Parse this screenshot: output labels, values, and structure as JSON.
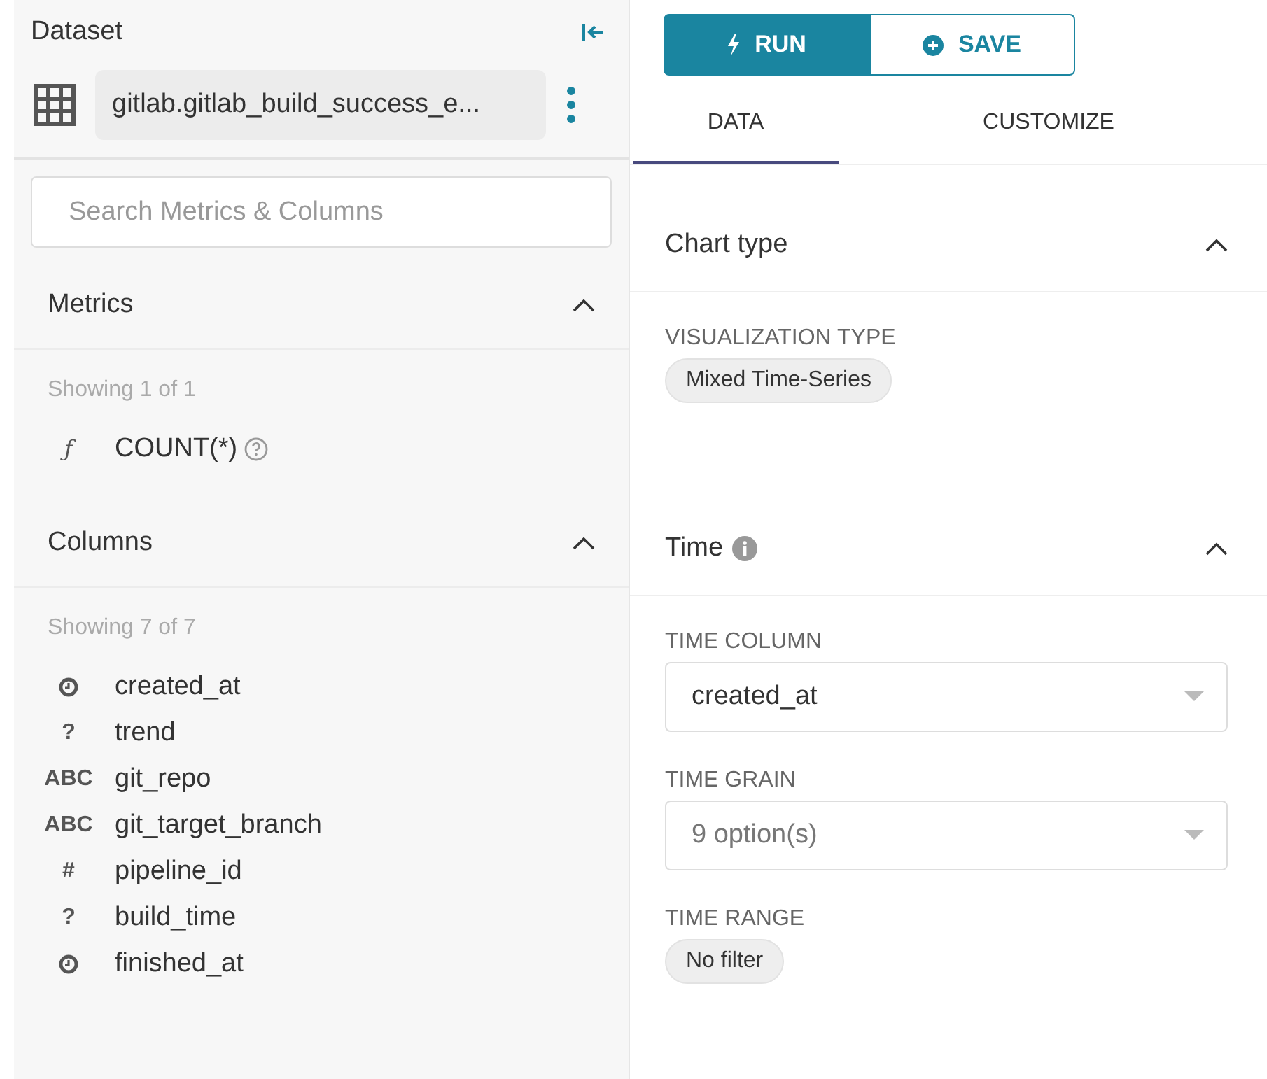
{
  "dataset": {
    "title": "Dataset",
    "name": "gitlab.gitlab_build_success_e..."
  },
  "search": {
    "placeholder": "Search Metrics & Columns"
  },
  "metrics": {
    "title": "Metrics",
    "expanded": true,
    "showing": "Showing 1 of 1",
    "items": [
      {
        "symbol": "ƒ",
        "name": "COUNT(*)",
        "help": true
      }
    ]
  },
  "columns": {
    "title": "Columns",
    "expanded": true,
    "showing": "Showing 7 of 7",
    "items": [
      {
        "kind": "time",
        "name": "created_at"
      },
      {
        "kind": "symbol",
        "symbol": "?",
        "name": "trend"
      },
      {
        "kind": "symbol",
        "symbol": "ABC",
        "name": "git_repo"
      },
      {
        "kind": "symbol",
        "symbol": "ABC",
        "name": "git_target_branch"
      },
      {
        "kind": "symbol",
        "symbol": "#",
        "name": "pipeline_id"
      },
      {
        "kind": "symbol",
        "symbol": "?",
        "name": "build_time"
      },
      {
        "kind": "time",
        "name": "finished_at"
      }
    ]
  },
  "buttons": [
    {
      "kind": "run",
      "label": "RUN"
    },
    {
      "kind": "save",
      "label": "SAVE"
    }
  ],
  "tabs": [
    {
      "label": "DATA",
      "selected": true
    },
    {
      "label": "CUSTOMIZE",
      "selected": false
    }
  ],
  "sections": [
    {
      "title": "Chart type",
      "info": false,
      "expanded": true,
      "fields": [
        {
          "kind": "pill",
          "label": "VISUALIZATION TYPE",
          "value": "Mixed Time-Series"
        }
      ]
    },
    {
      "title": "Time",
      "info": true,
      "expanded": true,
      "fields": [
        {
          "kind": "select",
          "label": "TIME COLUMN",
          "value": "created_at"
        },
        {
          "kind": "select",
          "label": "TIME GRAIN",
          "placeholder": "9 option(s)"
        },
        {
          "kind": "pill",
          "label": "TIME RANGE",
          "value": "No filter"
        }
      ]
    }
  ]
}
